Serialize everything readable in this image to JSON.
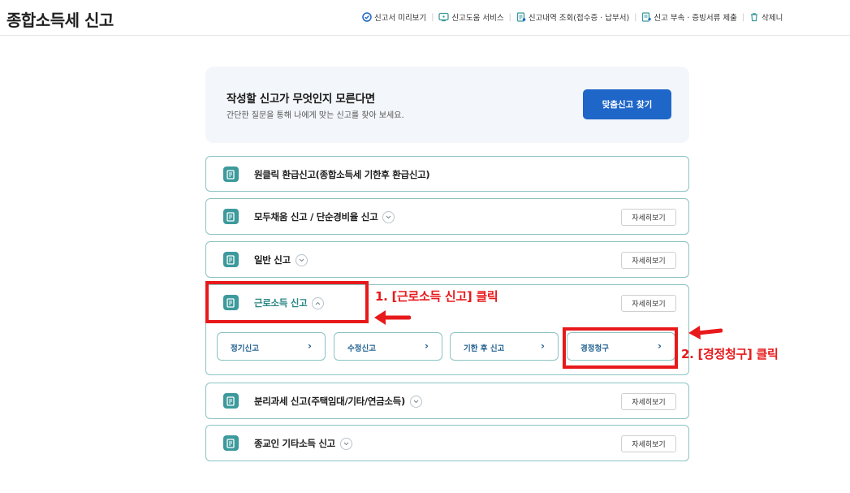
{
  "header": {
    "title": "종합소득세 신고",
    "nav": [
      {
        "label": "신고서 미리보기",
        "icon": "preview-icon"
      },
      {
        "label": "신고도움 서비스",
        "icon": "help-service-icon"
      },
      {
        "label": "신고내역 조회(접수증 · 납부서)",
        "icon": "history-icon"
      },
      {
        "label": "신고 부속 · 증빙서류 제출",
        "icon": "document-submit-icon"
      },
      {
        "label": "삭제니",
        "icon": "trash-icon"
      }
    ]
  },
  "promo": {
    "title": "작성할 신고가 무엇인지 모른다면",
    "subtitle": "간단한 질문을 통해 나에게 맞는 신고를 찾아 보세요.",
    "button": "맞춤신고 찾기"
  },
  "sections": [
    {
      "label": "원클릭 환급신고(종합소득세 기한후 환급신고)",
      "toggle": "none",
      "detail": ""
    },
    {
      "label": "모두채움 신고 / 단순경비율 신고",
      "toggle": "chevron-down",
      "detail": "자세히보기"
    },
    {
      "label": "일반 신고",
      "toggle": "chevron-down",
      "detail": "자세히보기"
    },
    {
      "label": "근로소득 신고",
      "toggle": "chevron-up",
      "detail": "자세히보기",
      "expanded": true
    },
    {
      "label": "분리과세 신고(주택임대/기타/연금소득)",
      "toggle": "chevron-down",
      "detail": "자세히보기"
    },
    {
      "label": "종교인 기타소득 신고",
      "toggle": "chevron-down",
      "detail": "자세히보기"
    }
  ],
  "sub_options": [
    {
      "label": "정기신고",
      "arrow": "›"
    },
    {
      "label": "수정신고",
      "arrow": "›"
    },
    {
      "label": "기한 후 신고",
      "arrow": "›"
    },
    {
      "label": "경정청구",
      "arrow": "›"
    }
  ],
  "annotations": {
    "step1": "1. [근로소득 신고] 클릭",
    "step2": "2. [경정청구] 클릭",
    "color": "#e8191b"
  },
  "colors": {
    "accent_teal": "#3d9a9c",
    "primary_blue": "#1f66c9",
    "border_teal": "#8cc3c3"
  }
}
